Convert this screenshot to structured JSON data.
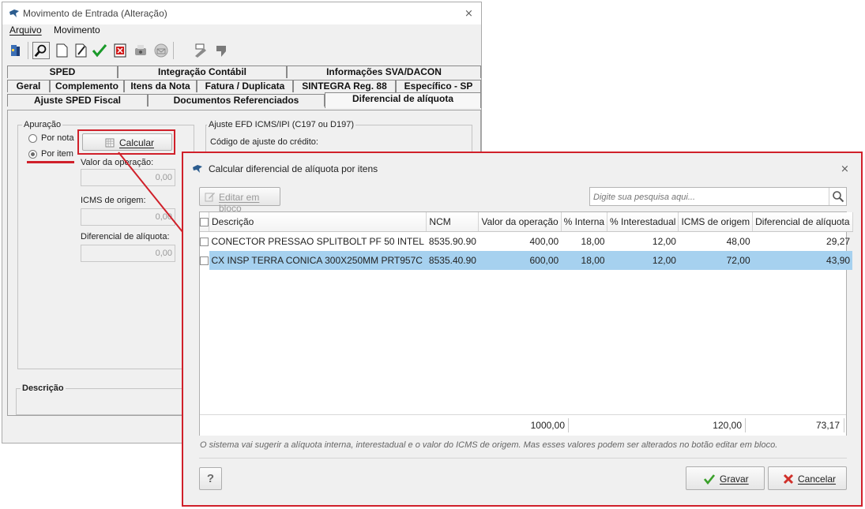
{
  "background_window": {
    "title": "Movimento de Entrada (Alteração)",
    "menu": [
      "Arquivo",
      "Movimento"
    ],
    "toolbar_icons": [
      "exit-icon",
      "search-icon",
      "new-document-icon",
      "edit-document-icon",
      "confirm-icon",
      "delete-icon",
      "print-icon",
      "mail-icon",
      "tools-icon",
      "arrow-icon"
    ],
    "tabs_row1": [
      "SPED",
      "Integração Contábil",
      "Informações SVA/DACON"
    ],
    "tabs_row2": [
      "Geral",
      "Complemento",
      "Itens da Nota",
      "Fatura / Duplicata",
      "SINTEGRA Reg. 88",
      "Específico - SP"
    ],
    "tabs_row3": [
      "Ajuste SPED Fiscal",
      "Documentos Referenciados",
      "Diferencial de alíquota"
    ],
    "apuracao": {
      "label": "Apuração",
      "option_nota": "Por nota",
      "option_item": "Por item",
      "calcular_label": "Calcular",
      "valor_operacao_label": "Valor da operação:",
      "valor_operacao": "0,00",
      "icms_origem_label": "ICMS de origem:",
      "icms_origem": "0,00",
      "diferencial_label": "Diferencial de alíquota:",
      "diferencial": "0,00"
    },
    "ajuste_group_label": "Ajuste EFD ICMS/IPI (C197 ou D197)",
    "codigo_ajuste_label": "Código de ajuste do crédito:",
    "descricao_label": "Descrição"
  },
  "dialog": {
    "title": "Calcular diferencial de alíquota por itens",
    "edit_block_label": "Editar em bloco",
    "search_placeholder": "Digite sua pesquisa aqui...",
    "columns": [
      "Descrição",
      "NCM",
      "Valor da operação",
      "% Interna",
      "% Interestadual",
      "ICMS de origem",
      "Diferencial de alíquota"
    ],
    "rows": [
      {
        "descricao": "CONECTOR PRESSAO SPLITBOLT PF 50 INTEL",
        "ncm": "8535.90.90",
        "valor": "400,00",
        "interna": "18,00",
        "interestadual": "12,00",
        "icms_origem": "48,00",
        "diferencial": "29,27",
        "selected": false
      },
      {
        "descricao": "CX INSP TERRA CONICA 300X250MM PRT957C",
        "ncm": "8535.40.90",
        "valor": "600,00",
        "interna": "18,00",
        "interestadual": "12,00",
        "icms_origem": "72,00",
        "diferencial": "43,90",
        "selected": true
      }
    ],
    "totals": {
      "valor": "1000,00",
      "icms_origem": "120,00",
      "diferencial": "73,17"
    },
    "note": "O sistema vai sugerir a alíquota interna, interestadual e o valor do ICMS de origem. Mas esses valores podem ser alterados no botão editar em bloco.",
    "help_label": "?",
    "save_label": "Gravar",
    "cancel_label": "Cancelar"
  },
  "colors": {
    "highlight_red": "#d0202a",
    "selected_row": "#a6d1ef"
  }
}
